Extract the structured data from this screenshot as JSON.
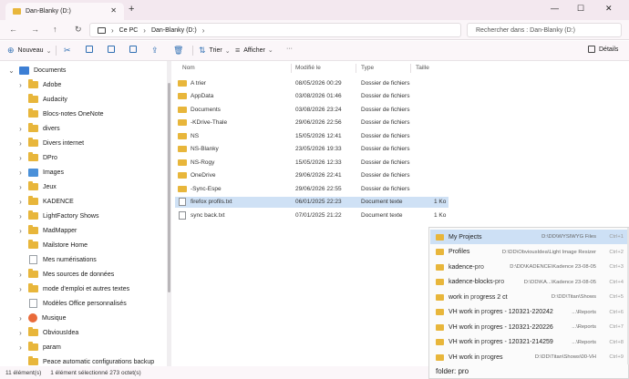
{
  "window": {
    "tab_title": "Dan-Blanky (D:)",
    "new_tab": "+",
    "minimize": "—",
    "maximize": "☐",
    "close": "✕"
  },
  "address": {
    "crumbs": [
      "Ce PC",
      "Dan-Blanky (D:)"
    ],
    "search_placeholder": "Rechercher dans : Dan-Blanky (D:)"
  },
  "toolbar": {
    "new_label": "Nouveau",
    "sort_label": "Trier",
    "view_label": "Afficher",
    "details_label": "Détails",
    "more": "···"
  },
  "sidebar": {
    "items": [
      {
        "label": "Documents",
        "icon": "documents-icon",
        "expanded": true,
        "level": 0
      },
      {
        "label": "Adobe",
        "icon": "folder-icon",
        "level": 1,
        "chevron": true
      },
      {
        "label": "Audacity",
        "icon": "folder-icon",
        "level": 1,
        "chevron": false
      },
      {
        "label": "Blocs-notes OneNote",
        "icon": "folder-icon",
        "level": 1,
        "chevron": false
      },
      {
        "label": "divers",
        "icon": "folder-icon",
        "level": 1,
        "chevron": true
      },
      {
        "label": "Divers internet",
        "icon": "folder-icon",
        "level": 1,
        "chevron": true
      },
      {
        "label": "DPro",
        "icon": "folder-icon",
        "level": 1,
        "chevron": true
      },
      {
        "label": "Images",
        "icon": "image-icon",
        "level": 1,
        "chevron": true
      },
      {
        "label": "Jeux",
        "icon": "folder-icon",
        "level": 1,
        "chevron": true
      },
      {
        "label": "KADENCE",
        "icon": "folder-icon",
        "level": 1,
        "chevron": true
      },
      {
        "label": "LightFactory Shows",
        "icon": "folder-icon",
        "level": 1,
        "chevron": true
      },
      {
        "label": "MadMapper",
        "icon": "folder-icon",
        "level": 1,
        "chevron": true
      },
      {
        "label": "Mailstore Home",
        "icon": "folder-icon",
        "level": 1,
        "chevron": false
      },
      {
        "label": "Mes numérisations",
        "icon": "document-icon",
        "level": 1,
        "chevron": false
      },
      {
        "label": "Mes sources de données",
        "icon": "folder-icon",
        "level": 1,
        "chevron": true
      },
      {
        "label": "mode d'emploi et autres textes",
        "icon": "folder-icon",
        "level": 1,
        "chevron": true
      },
      {
        "label": "Modèles Office personnalisés",
        "icon": "document-icon",
        "level": 1,
        "chevron": false
      },
      {
        "label": "Musique",
        "icon": "music-icon",
        "level": 1,
        "chevron": true
      },
      {
        "label": "ObviousIdea",
        "icon": "folder-icon",
        "level": 1,
        "chevron": true
      },
      {
        "label": "param",
        "icon": "folder-icon",
        "level": 1,
        "chevron": true
      },
      {
        "label": "Peace automatic configurations backup",
        "icon": "folder-icon",
        "level": 1,
        "chevron": false
      }
    ]
  },
  "filelist": {
    "columns": [
      "Nom",
      "Modifié le",
      "Type",
      "Taille"
    ],
    "rows": [
      {
        "name": "A trier",
        "date": "08/05/2026 00:29",
        "type": "Dossier de fichiers",
        "size": "",
        "kind": "folder"
      },
      {
        "name": "AppData",
        "date": "03/08/2026 01:46",
        "type": "Dossier de fichiers",
        "size": "",
        "kind": "folder"
      },
      {
        "name": "Documents",
        "date": "03/08/2026 23:24",
        "type": "Dossier de fichiers",
        "size": "",
        "kind": "folder"
      },
      {
        "name": "-KDrive-Thale",
        "date": "29/06/2026 22:56",
        "type": "Dossier de fichiers",
        "size": "",
        "kind": "folder"
      },
      {
        "name": "NS",
        "date": "15/05/2026 12:41",
        "type": "Dossier de fichiers",
        "size": "",
        "kind": "folder"
      },
      {
        "name": "NS-Blanky",
        "date": "23/05/2026 19:33",
        "type": "Dossier de fichiers",
        "size": "",
        "kind": "folder"
      },
      {
        "name": "NS-Rogy",
        "date": "15/05/2026 12:33",
        "type": "Dossier de fichiers",
        "size": "",
        "kind": "folder"
      },
      {
        "name": "OneDrive",
        "date": "29/06/2026 22:41",
        "type": "Dossier de fichiers",
        "size": "",
        "kind": "folder"
      },
      {
        "name": "-Sync-Espe",
        "date": "29/06/2026 22:55",
        "type": "Dossier de fichiers",
        "size": "",
        "kind": "folder"
      },
      {
        "name": "firefox profils.txt",
        "date": "06/01/2025 22:23",
        "type": "Document texte",
        "size": "1 Ko",
        "kind": "text",
        "selected": true
      },
      {
        "name": "sync back.txt",
        "date": "07/01/2025 21:22",
        "type": "Document texte",
        "size": "1 Ko",
        "kind": "text"
      }
    ]
  },
  "popup": {
    "items": [
      {
        "name_pre": "My Projects",
        "name_match": "",
        "name_post": "",
        "path": "D:\\DD\\WYSIWYG Files",
        "key": "Ctrl+1",
        "active": true
      },
      {
        "name_pre": "Profiles",
        "name_match": "",
        "name_post": "",
        "path": "D:\\DD\\ObviousIdea\\Light Image Resizer",
        "key": "Ctrl+2"
      },
      {
        "name_pre": "kadence-",
        "name_match": "pro",
        "name_post": "",
        "path": "D:\\DD\\KADENCE\\Kadence 23-08-05",
        "key": "Ctrl+3"
      },
      {
        "name_pre": "kadence-blocks-",
        "name_match": "pro",
        "name_post": "",
        "path": "D:\\DD\\KA...\\Kadence 23-08-05",
        "key": "Ctrl+4"
      },
      {
        "name_pre": "work in ",
        "name_match": "pro",
        "name_post": "gress 2 ct",
        "path": "D:\\DD\\Titan\\Shows",
        "key": "Ctrl+5"
      },
      {
        "name_pre": "VH work in ",
        "name_match": "pro",
        "name_post": "gres - 120321-220242",
        "path": "...\\Reports",
        "key": "Ctrl+6"
      },
      {
        "name_pre": "VH work in ",
        "name_match": "pro",
        "name_post": "gres - 120321-220226",
        "path": "...\\Reports",
        "key": "Ctrl+7"
      },
      {
        "name_pre": "VH work in ",
        "name_match": "pro",
        "name_post": "gres - 120321-214259",
        "path": "...\\Reports",
        "key": "Ctrl+8"
      },
      {
        "name_pre": "VH work in ",
        "name_match": "pro",
        "name_post": "gres",
        "path": "D:\\DD\\Titan\\Shows\\00-VH",
        "key": "Ctrl+9"
      }
    ],
    "query": "folder: pro"
  },
  "status": {
    "count": "11 élément(s)",
    "selection": "1 élément sélectionné  273 octet(s)"
  }
}
